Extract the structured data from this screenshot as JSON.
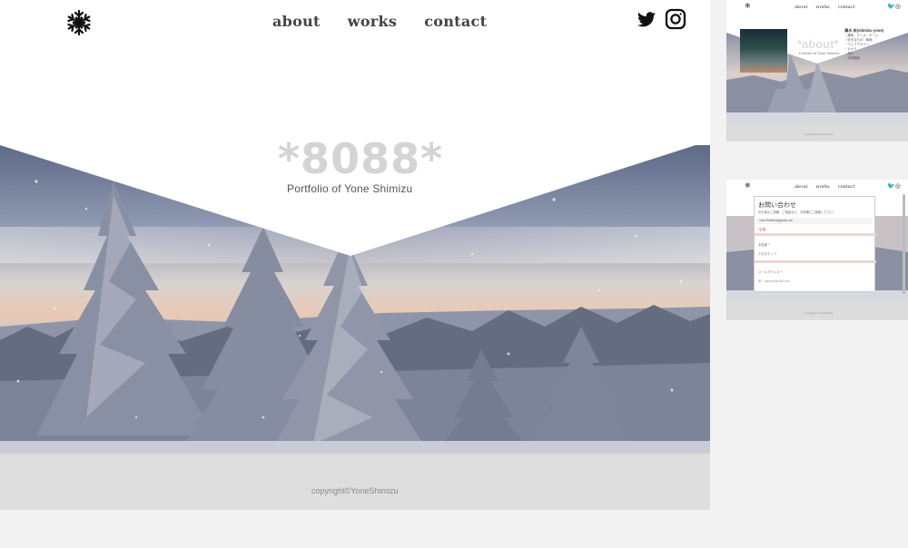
{
  "site": {
    "nav": {
      "links": [
        "about",
        "works",
        "contact"
      ],
      "logo_icon": "snowflake-icon",
      "social_icons": [
        "twitter-icon",
        "instagram-icon"
      ]
    },
    "hero": {
      "title": "*8088*",
      "subtitle": "Portfolio of Yone Shimizu"
    },
    "footer": {
      "copyright": "copyright©YoneShimizu"
    }
  },
  "thumb_about": {
    "nav_links": [
      "about",
      "works",
      "contact"
    ],
    "title": "*about*",
    "subtitle": "Portfolio of Yone Shimizu",
    "name_line": "清水 米(shimizu yone)",
    "lines": [
      "・趣味：アニメ、ゲーム",
      "・好きなもの：映画",
      "・ウェブデザイン",
      "・カメラ",
      "・旅行",
      "・写真撮影"
    ],
    "copyright": "copyright©YoneShimizu"
  },
  "thumb_contact": {
    "nav_links": [
      "about",
      "works",
      "contact"
    ],
    "heading": "お問い合わせ",
    "description": "お仕事のご依頼・ご相談など、お気軽にご連絡ください。",
    "email_row": "Yone.Shimizu@gmail.com",
    "required_mark": "*必須",
    "field_name": "お名前 *",
    "field_name_placeholder": "お名前を入力",
    "field_email": "メールアドレス *",
    "field_email_placeholder": "例：sample@mail.com",
    "copyright": "copyright©YoneShimizu"
  }
}
